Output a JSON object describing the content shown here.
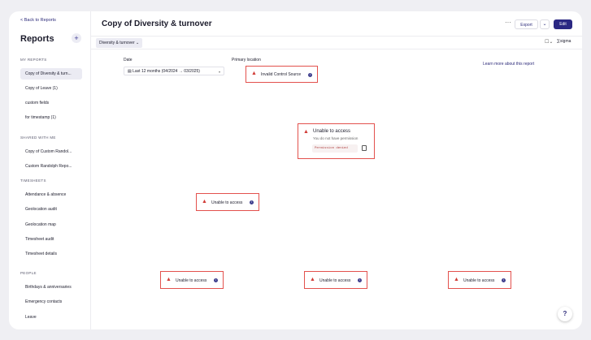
{
  "sidebar": {
    "back_label": "< Back to Reports",
    "title": "Reports",
    "add_label": "+",
    "sections": {
      "my_reports": "MY REPORTS",
      "shared": "SHARED WITH ME",
      "timesheets": "TIMESHEETS",
      "people": "PEOPLE"
    },
    "my_reports": [
      "Copy of Diversity & turn...",
      "Copy of Leave (1)",
      "custom fields",
      "for timestamp (1)"
    ],
    "shared": [
      "Copy of Custom Randol...",
      "Custom Randolph Repo..."
    ],
    "timesheets": [
      "Attendance & absence",
      "Geolocation audit",
      "Geolocation map",
      "Timesheet audit",
      "Timesheet details"
    ],
    "people": [
      "Birthdays & anniversaries",
      "Emergency contacts",
      "Leave"
    ]
  },
  "header": {
    "title": "Copy of Diversity & turnover",
    "more_label": "···",
    "export_label": "Export",
    "chevron": "⌄",
    "edit_label": "Edit"
  },
  "tabbar": {
    "tab_label": "Diversity & turnover",
    "tab_chevron": "⌄",
    "bookmark": "☐⌄",
    "sigma_label": "⅀sigma"
  },
  "filters": {
    "date_label": "Date",
    "date_value": "Last 12 months (04/2024 → 03/2025)",
    "location_label": "Primary location",
    "learn_more": "Learn more about this report"
  },
  "errors": {
    "invalid_source": "Invalid Control Source",
    "unable": "Unable to access",
    "no_permission": "You do not have permission",
    "permission_code": "Permission denied"
  },
  "colors": {
    "accent": "#2b2883",
    "error": "#e3514d"
  },
  "help_label": "?"
}
